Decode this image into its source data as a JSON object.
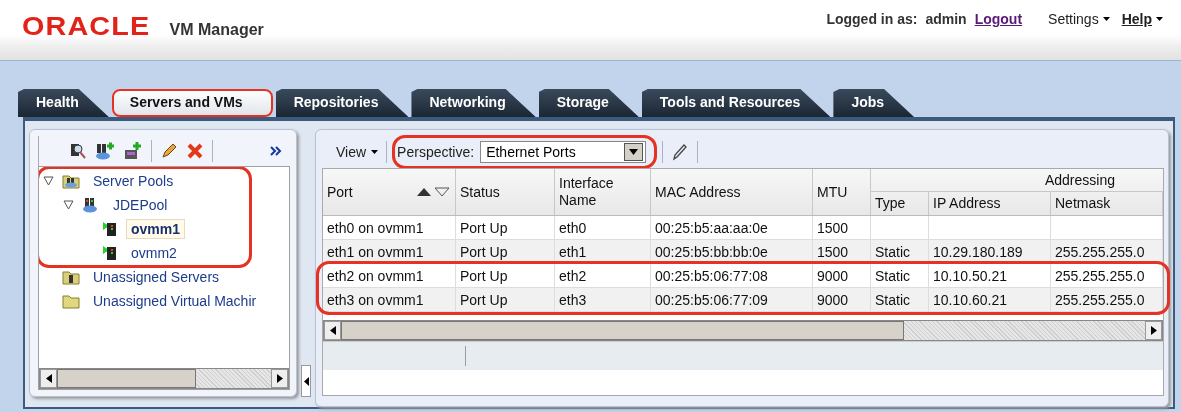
{
  "header": {
    "logo": "ORACLE",
    "product": "VM Manager",
    "logged_in_label": "Logged in as:",
    "user": "admin",
    "logout": "Logout",
    "menus": [
      {
        "label": "Settings",
        "bold": false
      },
      {
        "label": "Help",
        "bold": true
      }
    ]
  },
  "tabs": [
    {
      "label": "Health",
      "selected": false,
      "highlighted": false
    },
    {
      "label": "Servers and VMs",
      "selected": true,
      "highlighted": true
    },
    {
      "label": "Repositories",
      "selected": false,
      "highlighted": false
    },
    {
      "label": "Networking",
      "selected": false,
      "highlighted": false
    },
    {
      "label": "Storage",
      "selected": false,
      "highlighted": false
    },
    {
      "label": "Tools and Resources",
      "selected": false,
      "highlighted": false
    },
    {
      "label": "Jobs",
      "selected": false,
      "highlighted": false
    }
  ],
  "tree": [
    {
      "label": "Server Pools",
      "kind": "pool-folder",
      "expanded": true,
      "selected": false,
      "highlighted": true,
      "children": [
        {
          "label": "JDEPool",
          "kind": "pool",
          "expanded": true,
          "selected": false,
          "highlighted": false,
          "children": [
            {
              "label": "ovmm1",
              "kind": "server",
              "selected": true,
              "highlighted": false
            },
            {
              "label": "ovmm2",
              "kind": "server",
              "selected": false,
              "highlighted": false
            }
          ]
        }
      ]
    },
    {
      "label": "Unassigned Servers",
      "kind": "server-folder",
      "selected": false,
      "highlighted": false
    },
    {
      "label": "Unassigned Virtual Machir",
      "kind": "folder",
      "selected": false,
      "highlighted": false
    }
  ],
  "toolbar": {
    "view": "View",
    "perspective_label": "Perspective:",
    "perspective": "Ethernet Ports",
    "perspective_highlighted": true
  },
  "table": {
    "columns": [
      "Port",
      "Status",
      "Interface Name",
      "MAC Address",
      "MTU"
    ],
    "group": "Addressing",
    "sub_columns": [
      "Type",
      "IP Address",
      "Netmask"
    ],
    "rows": [
      {
        "cells": [
          "eth0 on ovmm1",
          "Port Up",
          "eth0",
          "00:25:b5:aa:aa:0e",
          "1500"
        ],
        "addressing": [],
        "highlighted": false
      },
      {
        "cells": [
          "eth1 on ovmm1",
          "Port Up",
          "eth1",
          "00:25:b5:bb:bb:0e",
          "1500"
        ],
        "addressing": [
          "Static",
          "10.29.180.189",
          "255.255.255.0"
        ],
        "highlighted": false
      },
      {
        "cells": [
          "eth2 on ovmm1",
          "Port Up",
          "eth2",
          "00:25:b5:06:77:08",
          "9000"
        ],
        "addressing": [
          "Static",
          "10.10.50.21",
          "255.255.255.0"
        ],
        "highlighted": true
      },
      {
        "cells": [
          "eth3 on ovmm1",
          "Port Up",
          "eth3",
          "00:25:b5:06:77:09",
          "9000"
        ],
        "addressing": [
          "Static",
          "10.10.60.21",
          "255.255.255.0"
        ],
        "highlighted": true
      }
    ]
  }
}
